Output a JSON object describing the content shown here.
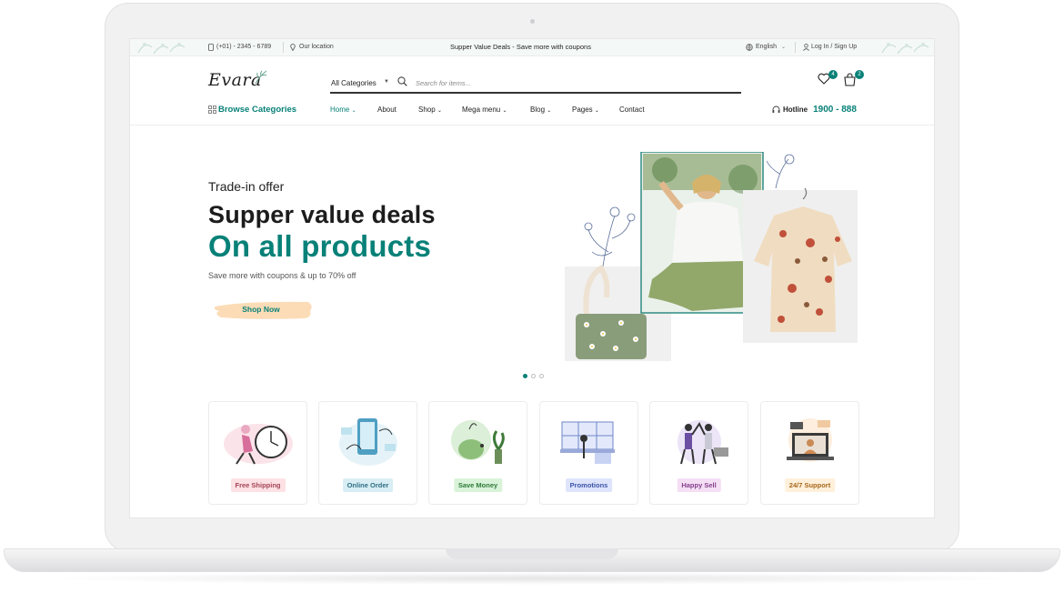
{
  "topbar": {
    "phone": "(+01) - 2345 - 6789",
    "location": "Our location",
    "promo": "Supper Value Deals - Save more with coupons",
    "language": "English",
    "login": "Log In / Sign Up"
  },
  "header": {
    "logo": "Evara",
    "search": {
      "category": "All Categories",
      "placeholder": "Search for items..."
    },
    "wishlist_count": "4",
    "cart_count": "2"
  },
  "nav": {
    "browse": "Browse Categories",
    "items": [
      {
        "label": "Home",
        "dropdown": true,
        "active": true
      },
      {
        "label": "About",
        "dropdown": false
      },
      {
        "label": "Shop",
        "dropdown": true
      },
      {
        "label": "Mega menu",
        "dropdown": true
      },
      {
        "label": "Blog",
        "dropdown": true
      },
      {
        "label": "Pages",
        "dropdown": true
      },
      {
        "label": "Contact",
        "dropdown": false
      }
    ],
    "hotline_label": "Hotline",
    "hotline_number": "1900 - 888"
  },
  "hero": {
    "subtitle": "Trade-in offer",
    "title": "Supper value deals",
    "highlight": "On all products",
    "description": "Save more with coupons & up to 70% off",
    "button": "Shop Now",
    "slides": 3,
    "active_slide": 1
  },
  "features": [
    {
      "label": "Free Shipping",
      "icon": "delivery-clock-icon",
      "color": "#fde1e4",
      "text_color": "#a34455"
    },
    {
      "label": "Online Order",
      "icon": "mobile-order-icon",
      "color": "#d8eef4",
      "text_color": "#2f6e85"
    },
    {
      "label": "Save Money",
      "icon": "piggy-bank-icon",
      "color": "#d9f3d9",
      "text_color": "#2f7b3a"
    },
    {
      "label": "Promotions",
      "icon": "promotion-megaphone-icon",
      "color": "#dde4fb",
      "text_color": "#3d55a8"
    },
    {
      "label": "Happy Sell",
      "icon": "high-five-icon",
      "color": "#f4dff5",
      "text_color": "#85408a"
    },
    {
      "label": "24/7 Support",
      "icon": "support-laptop-icon",
      "color": "#fff0db",
      "text_color": "#a7671c"
    }
  ],
  "colors": {
    "brand": "#088178",
    "button_bg": "#fcdcb7"
  }
}
